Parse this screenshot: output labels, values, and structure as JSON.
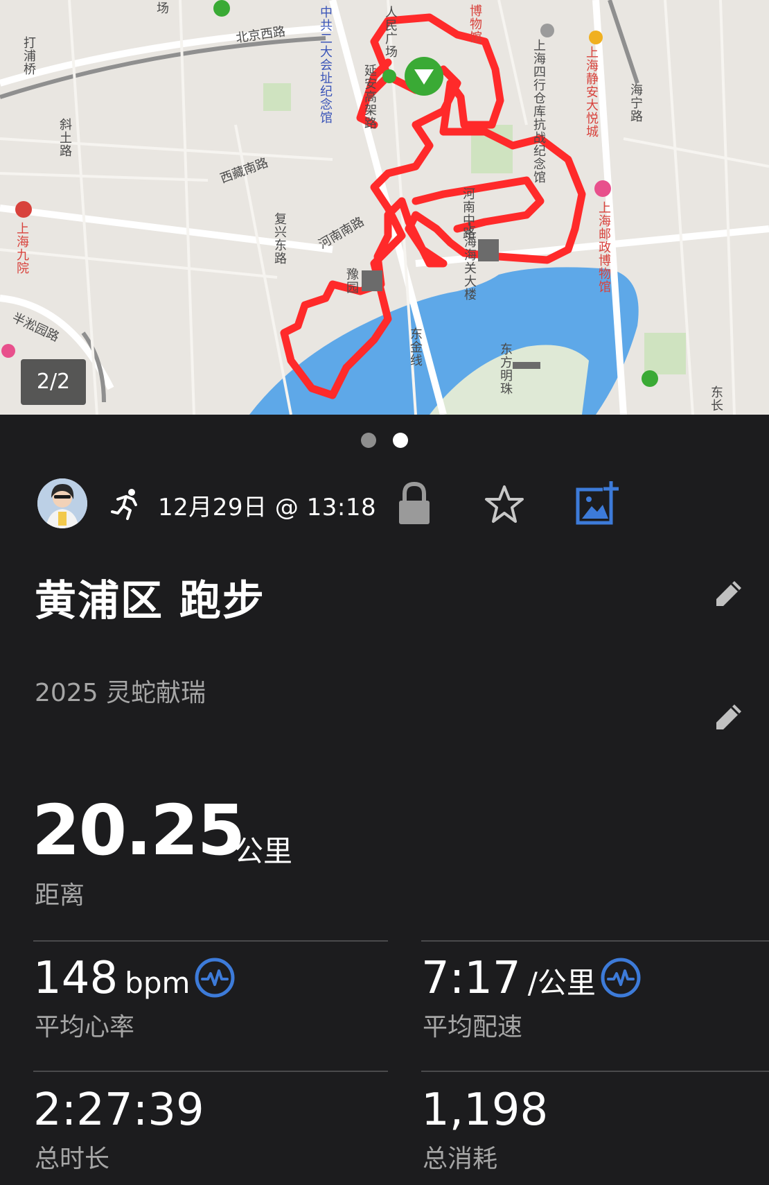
{
  "map": {
    "counter": "2/2",
    "page_dots": 2,
    "active_page": 2,
    "route_color": "#ff2a2a",
    "water_color": "#5ea8e8",
    "labels": {
      "dapu_qiao": "打浦桥",
      "xietu_lu": "斜土路",
      "shanghai_jiuyuan": "上海九院",
      "bansong_yuan_lu": "半淞园路",
      "beijing_xi_lu": "北京西路",
      "zhongyi_dahui": "中共二大会址纪念馆",
      "yanan_gaojia_lu": "延安高架路",
      "renmin_guangchang": "人民广场",
      "bowuguan": "博物馆",
      "xizang_nan_lu": "西藏南路",
      "fuxing_dong_lu": "复兴东路",
      "henan_nan_lu": "河南南路",
      "yuyuan": "豫园",
      "henan_zhong_lu": "河南中路",
      "haiguan_dalou": "上海海关大楼",
      "sihang_cangku": "上海四行仓库抗战纪念馆",
      "jingan_dayuecheng": "上海静安大悦城",
      "haining_lu": "海宁路",
      "youzheng_bowuguan": "上海邮政博物馆",
      "dongjin_xian": "东金线",
      "dongfang_mingzhu": "东方明珠",
      "changchang": "场",
      "dongchang": "东长"
    }
  },
  "activity": {
    "date_time": "12月29日 @ 13:18",
    "title": "黄浦区 跑步",
    "description": "2025 灵蛇献瑞",
    "distance": {
      "value": "20.25",
      "unit": "公里",
      "label": "距离"
    },
    "heart_rate": {
      "value": "148",
      "unit": "bpm",
      "label": "平均心率"
    },
    "pace": {
      "value": "7:17",
      "unit": "/公里",
      "label": "平均配速"
    },
    "duration": {
      "value": "2:27:39",
      "label": "总时长"
    },
    "calories": {
      "value": "1,198",
      "label": "总消耗"
    }
  },
  "colors": {
    "background": "#1c1c1e",
    "accent_blue": "#3d7bd9",
    "secondary_text": "#a6a6a6",
    "icon_gray": "#9a9a9a"
  },
  "icons": [
    "running-icon",
    "lock-icon",
    "star-icon",
    "add-photo-icon",
    "edit-icon",
    "heart-pulse-icon",
    "pace-pulse-icon"
  ]
}
